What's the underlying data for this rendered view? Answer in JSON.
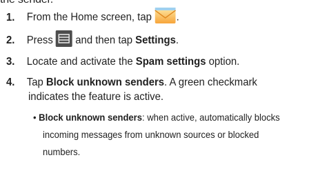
{
  "intro_fragment": "the sender.",
  "steps": [
    {
      "number": "1.",
      "text_before": "From the Home screen, tap",
      "icon": "email-app-icon",
      "text_after": "."
    },
    {
      "number": "2.",
      "text_before": "Press",
      "icon": "menu-key-icon",
      "text_middle": "and then tap",
      "bold": "Settings",
      "text_after": "."
    },
    {
      "number": "3.",
      "text_before": "Locate and activate the",
      "bold": "Spam settings",
      "text_after": "option."
    },
    {
      "number": "4.",
      "bold": "Block unknown senders",
      "text_before": "Tap",
      "text_after": ". A green checkmark",
      "continuation": "indicates the feature is active."
    }
  ],
  "bullet": {
    "symbol": "•",
    "bold": "Block unknown senders",
    "line1": ": when active, automatically blocks",
    "line2": "incoming messages from unknown sources or blocked",
    "line3": "numbers."
  },
  "colors": {
    "text": "#1f1f1f",
    "email_icon_top": "#fde9a6",
    "email_icon_bottom": "#f7a43a",
    "menu_key_bg": "#4d4d4d"
  }
}
